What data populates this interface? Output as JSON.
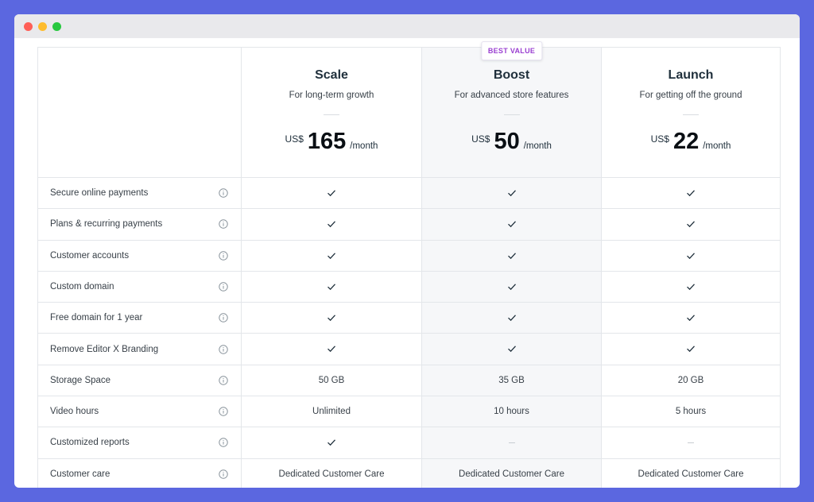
{
  "plans": [
    {
      "name": "Scale",
      "description": "For long-term growth",
      "currency": "US$",
      "price": "165",
      "period": "/month"
    },
    {
      "name": "Boost",
      "description": "For advanced store features",
      "currency": "US$",
      "price": "50",
      "period": "/month",
      "badge": "BEST VALUE"
    },
    {
      "name": "Launch",
      "description": "For getting off the ground",
      "currency": "US$",
      "price": "22",
      "period": "/month"
    }
  ],
  "features": [
    {
      "label": "Secure online payments",
      "values": [
        "check",
        "check",
        "check"
      ]
    },
    {
      "label": "Plans & recurring payments",
      "values": [
        "check",
        "check",
        "check"
      ]
    },
    {
      "label": "Customer accounts",
      "values": [
        "check",
        "check",
        "check"
      ]
    },
    {
      "label": "Custom domain",
      "values": [
        "check",
        "check",
        "check"
      ]
    },
    {
      "label": "Free domain for 1 year",
      "values": [
        "check",
        "check",
        "check"
      ]
    },
    {
      "label": "Remove Editor X Branding",
      "values": [
        "check",
        "check",
        "check"
      ]
    },
    {
      "label": "Storage Space",
      "values": [
        "50 GB",
        "35 GB",
        "20 GB"
      ]
    },
    {
      "label": "Video hours",
      "values": [
        "Unlimited",
        "10 hours",
        "5 hours"
      ]
    },
    {
      "label": "Customized reports",
      "values": [
        "check",
        "dash",
        "dash"
      ]
    },
    {
      "label": "Customer care",
      "values": [
        "Dedicated Customer Care",
        "Dedicated Customer Care",
        "Dedicated Customer Care"
      ]
    }
  ],
  "icons": {
    "info": "info-icon",
    "included": "checkmark-icon",
    "not_included": "dash-icon"
  },
  "colors": {
    "background": "#5b67e0",
    "badge_text": "#9a3fd1",
    "highlight_column": "#f6f7f9"
  }
}
